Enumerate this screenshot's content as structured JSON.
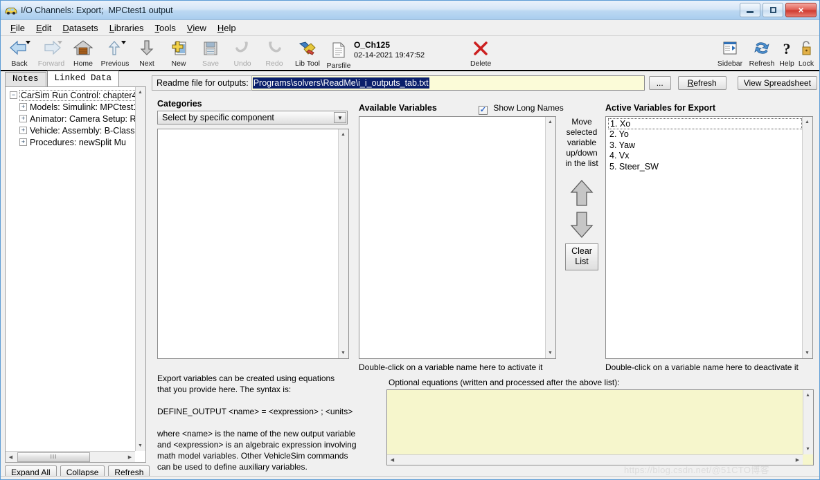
{
  "window": {
    "title": "I/O Channels: Export;  MPCtest1 output",
    "icon": "car-icon",
    "minimize_label": "minimize-icon",
    "maximize_label": "maximize-icon",
    "close_label": "×"
  },
  "menubar": {
    "items": [
      {
        "label": "File",
        "accel": "F"
      },
      {
        "label": "Edit",
        "accel": "E"
      },
      {
        "label": "Datasets",
        "accel": "D"
      },
      {
        "label": "Libraries",
        "accel": "L"
      },
      {
        "label": "Tools",
        "accel": "T"
      },
      {
        "label": "View",
        "accel": "V"
      },
      {
        "label": "Help",
        "accel": "H"
      }
    ]
  },
  "toolbar": {
    "items": [
      {
        "label": "Back",
        "icon": "back-arrow-icon",
        "enabled": true,
        "dropdown": true
      },
      {
        "label": "Forward",
        "icon": "forward-arrow-icon",
        "enabled": false,
        "dropdown": true
      },
      {
        "label": "Home",
        "icon": "home-icon",
        "enabled": true,
        "dropdown": false
      },
      {
        "label": "Previous",
        "icon": "up-arrow-icon",
        "enabled": true,
        "dropdown": true
      },
      {
        "label": "Next",
        "icon": "down-arrow-icon",
        "enabled": true,
        "dropdown": false
      },
      {
        "label": "New",
        "icon": "new-document-icon",
        "enabled": true,
        "dropdown": false
      },
      {
        "label": "Save",
        "icon": "floppy-disk-icon",
        "enabled": false,
        "dropdown": false
      },
      {
        "label": "Undo",
        "icon": "undo-arrow-icon",
        "enabled": false,
        "dropdown": false
      },
      {
        "label": "Redo",
        "icon": "redo-arrow-icon",
        "enabled": false,
        "dropdown": false
      },
      {
        "label": "Lib Tool",
        "icon": "wrench-icon",
        "enabled": true,
        "dropdown": false
      }
    ],
    "parsfile": {
      "label": "Parsfile",
      "icon": "parsfile-document-icon",
      "name": "O_Ch125",
      "date": "02-14-2021 19:47:52"
    },
    "delete": {
      "label": "Delete",
      "icon": "red-x-icon"
    },
    "right_items": [
      {
        "label": "Sidebar",
        "icon": "sidebar-icon"
      },
      {
        "label": "Refresh",
        "icon": "refresh-icon"
      },
      {
        "label": "Help",
        "icon": "question-mark-icon"
      },
      {
        "label": "Lock",
        "icon": "padlock-icon"
      }
    ]
  },
  "tabs": [
    {
      "label": "Notes",
      "active": false
    },
    {
      "label": "Linked Data",
      "active": true
    }
  ],
  "tree": {
    "items": [
      {
        "label": "CarSim Run Control: chapter4",
        "expander": "−",
        "level": 0,
        "focused": true
      },
      {
        "label": "Models: Simulink: MPCtest1",
        "expander": "+",
        "level": 1,
        "focused": false
      },
      {
        "label": "Animator: Camera Setup: R",
        "expander": "+",
        "level": 1,
        "focused": false
      },
      {
        "label": "Vehicle: Assembly: B-Class",
        "expander": "+",
        "level": 1,
        "focused": false
      },
      {
        "label": "Procedures: newSplit Mu",
        "expander": "+",
        "level": 1,
        "focused": false
      }
    ],
    "buttons": [
      {
        "label": "Expand All"
      },
      {
        "label": "Collapse"
      },
      {
        "label": "Refresh"
      }
    ],
    "scroll_thumb_glyph": "III"
  },
  "readme": {
    "label": "Readme file for outputs:",
    "value": "Programs\\solvers\\ReadMe\\i_i_outputs_tab.txt",
    "browse_label": "...",
    "refresh_label": "Refresh",
    "refresh_accel": "R",
    "view_spreadsheet_label": "View Spreadsheet"
  },
  "categories": {
    "heading": "Categories",
    "selected": "Select by specific component",
    "dropdown_icon": "chevron-down-icon",
    "items": []
  },
  "available": {
    "heading": "Available Variables",
    "checkbox_label": "Show Long Names",
    "checkbox_checked": true,
    "items": [],
    "hint": "Double-click on a variable name here to activate it"
  },
  "move": {
    "caption": "Move\nselected\nvariable\nup/down\nin the list",
    "up_icon": "arrow-up-icon",
    "down_icon": "arrow-down-icon",
    "clear_label": "Clear\nList"
  },
  "active": {
    "heading": "Active Variables for Export",
    "items": [
      "1. Xo",
      "2. Yo",
      "3. Yaw",
      "4. Vx",
      "5. Steer_SW"
    ],
    "focused_index": 0,
    "hint": "Double-click on a variable name here to deactivate it"
  },
  "description": "Export variables can be created using equations\nthat you provide here. The syntax is:\n\nDEFINE_OUTPUT <name> = <expression> ; <units>\n\nwhere <name> is the name of the new output variable\nand <expression> is an algebraic expression involving\nmath model variables. Other VehicleSim commands\ncan be used to define auxiliary variables.",
  "optional_equations": {
    "label": "Optional equations (written and processed after the above list):",
    "value": ""
  },
  "watermark": "https://blog.csdn.net/@51CTO博客",
  "colors": {
    "accent": "#a9cdee",
    "field_yellow": "#fbfbd8",
    "selection_blue": "#0a1f6b",
    "close_red": "#cf3b30"
  }
}
